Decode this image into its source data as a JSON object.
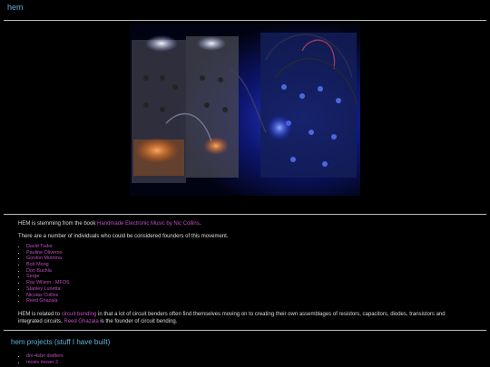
{
  "site": {
    "title": "hem"
  },
  "intro": {
    "prefix": "HEM is stemming from the book ",
    "book_link": "Handmade Electronic Music by Nic Collins",
    "suffix": "."
  },
  "founders_intro": "There are a number of individuals who could be considered founders of this movement.",
  "founders": [
    "David Tudor",
    "Pauline Oliveros",
    "Gordon Mumma",
    "Bob Moog",
    "Don Buchla",
    "Serge",
    "Ray Wilson - MFOS",
    "Stanley Lunetta",
    "Nicolas Collins",
    "Reed Ghazala"
  ],
  "related": {
    "p1": "HEM is related to ",
    "link1": "circuit bending",
    "p2": " in that a lot of circuit benders often find themselves moving on to creating their own assemblages of resistors, capacitors, diodes, transistors and integrated circuits. ",
    "link2": "Reed Ghazala",
    "p3": " is the founder of circuit bending."
  },
  "projects": {
    "heading": "hem projects (stuff I have built)",
    "items": [
      "drv-4sbn drafters",
      "mosis moser 2"
    ]
  },
  "colors": {
    "background": "#000000",
    "heading": "#5fb3d9",
    "link": "#c04ec0",
    "text": "#dcdcdc"
  }
}
